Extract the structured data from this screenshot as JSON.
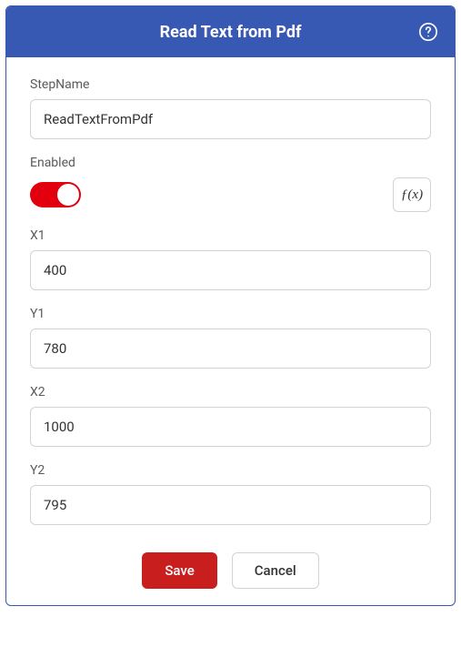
{
  "header": {
    "title": "Read Text from Pdf"
  },
  "fields": {
    "stepName": {
      "label": "StepName",
      "value": "ReadTextFromPdf"
    },
    "enabled": {
      "label": "Enabled",
      "on": true
    },
    "fx": {
      "label": "ƒ(x)"
    },
    "x1": {
      "label": "X1",
      "value": "400"
    },
    "y1": {
      "label": "Y1",
      "value": "780"
    },
    "x2": {
      "label": "X2",
      "value": "1000"
    },
    "y2": {
      "label": "Y2",
      "value": "795"
    }
  },
  "buttons": {
    "save": "Save",
    "cancel": "Cancel"
  }
}
